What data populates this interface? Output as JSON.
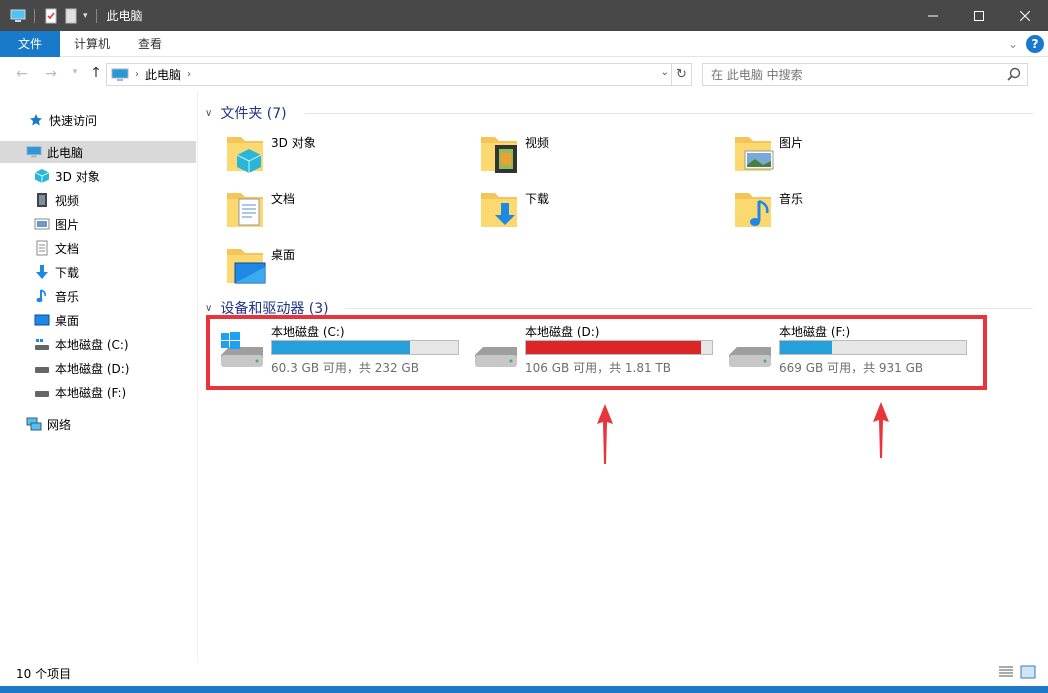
{
  "title_bar": {
    "title": "此电脑",
    "controls": [
      "minimize",
      "maximize",
      "close"
    ]
  },
  "ribbon": {
    "tabs": [
      "文件",
      "计算机",
      "查看"
    ]
  },
  "address": {
    "crumb": "此电脑",
    "search_placeholder": "在 此电脑 中搜索"
  },
  "nav": {
    "quick_access": "快速访问",
    "this_pc": "此电脑",
    "items": [
      {
        "label": "3D 对象",
        "icon": "3d-objects-icon"
      },
      {
        "label": "视频",
        "icon": "video-icon"
      },
      {
        "label": "图片",
        "icon": "pictures-icon"
      },
      {
        "label": "文档",
        "icon": "documents-icon"
      },
      {
        "label": "下载",
        "icon": "downloads-icon"
      },
      {
        "label": "音乐",
        "icon": "music-icon"
      },
      {
        "label": "桌面",
        "icon": "desktop-icon"
      },
      {
        "label": "本地磁盘 (C:)",
        "icon": "drive-c-icon"
      },
      {
        "label": "本地磁盘 (D:)",
        "icon": "drive-icon"
      },
      {
        "label": "本地磁盘 (F:)",
        "icon": "drive-icon"
      }
    ],
    "network": "网络"
  },
  "folders_group": {
    "header": "文件夹 (7)",
    "folders": [
      {
        "name": "3D 对象",
        "icon": "folder-3d-icon"
      },
      {
        "name": "视频",
        "icon": "folder-video-icon"
      },
      {
        "name": "图片",
        "icon": "folder-pictures-icon"
      },
      {
        "name": "文档",
        "icon": "folder-documents-icon"
      },
      {
        "name": "下载",
        "icon": "folder-downloads-icon"
      },
      {
        "name": "音乐",
        "icon": "folder-music-icon"
      },
      {
        "name": "桌面",
        "icon": "folder-desktop-icon"
      }
    ]
  },
  "drives_group": {
    "header": "设备和驱动器 (3)",
    "drives": [
      {
        "name": "本地磁盘 (C:)",
        "size_text": "60.3 GB 可用，共 232 GB",
        "used_fraction": 0.74,
        "bar_color": "#26a0da"
      },
      {
        "name": "本地磁盘 (D:)",
        "size_text": "106 GB 可用，共 1.81 TB",
        "used_fraction": 0.94,
        "bar_color": "#da2626"
      },
      {
        "name": "本地磁盘 (F:)",
        "size_text": "669 GB 可用，共 931 GB",
        "used_fraction": 0.28,
        "bar_color": "#26a0da"
      }
    ]
  },
  "status": {
    "item_count": "10 个项目"
  },
  "colors": {
    "accent": "#1979ca",
    "highlight_border": "#e8353b",
    "group_header": "#1e3287"
  }
}
